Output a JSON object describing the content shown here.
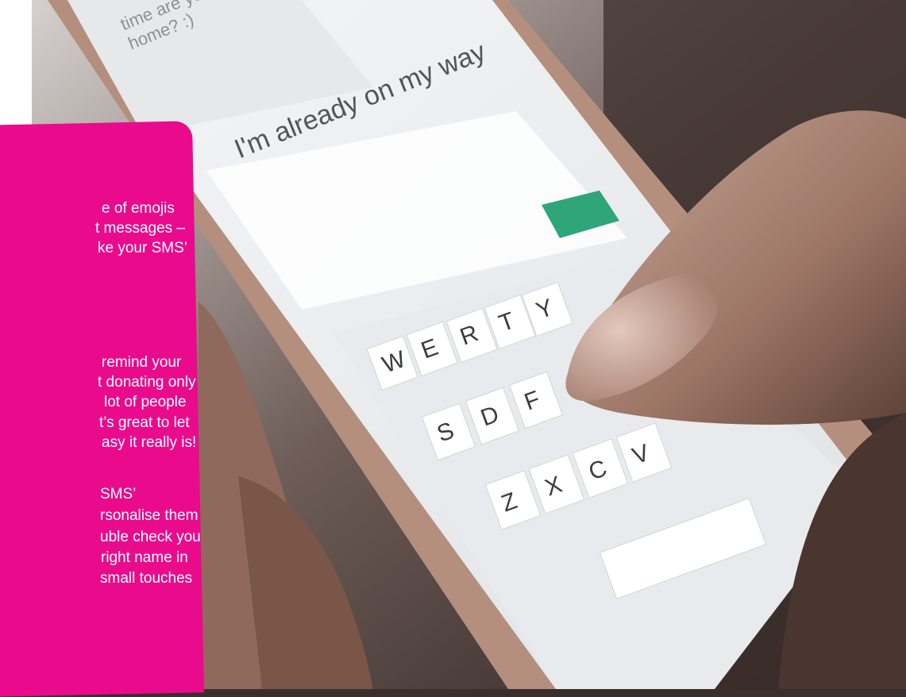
{
  "card": {
    "lines": [
      "e of emojis",
      "t messages –",
      "ke your SMS’",
      "remind your",
      "t donating only",
      "lot of people",
      "t’s great to let",
      "asy it really is!",
      "SMS’",
      "rsonalise them",
      "uble check you",
      "right name in",
      "small touches"
    ]
  },
  "phone": {
    "message": "I'm already on my way",
    "top_message_1": "time are you",
    "top_message_2": "home? :)",
    "keys": [
      "W",
      "E",
      "R",
      "T",
      "Y",
      "S",
      "D",
      "F",
      "Z",
      "X",
      "C",
      "V"
    ]
  },
  "colors": {
    "card_pink": "#ea0b8c",
    "send_green": "#2fa57a"
  }
}
